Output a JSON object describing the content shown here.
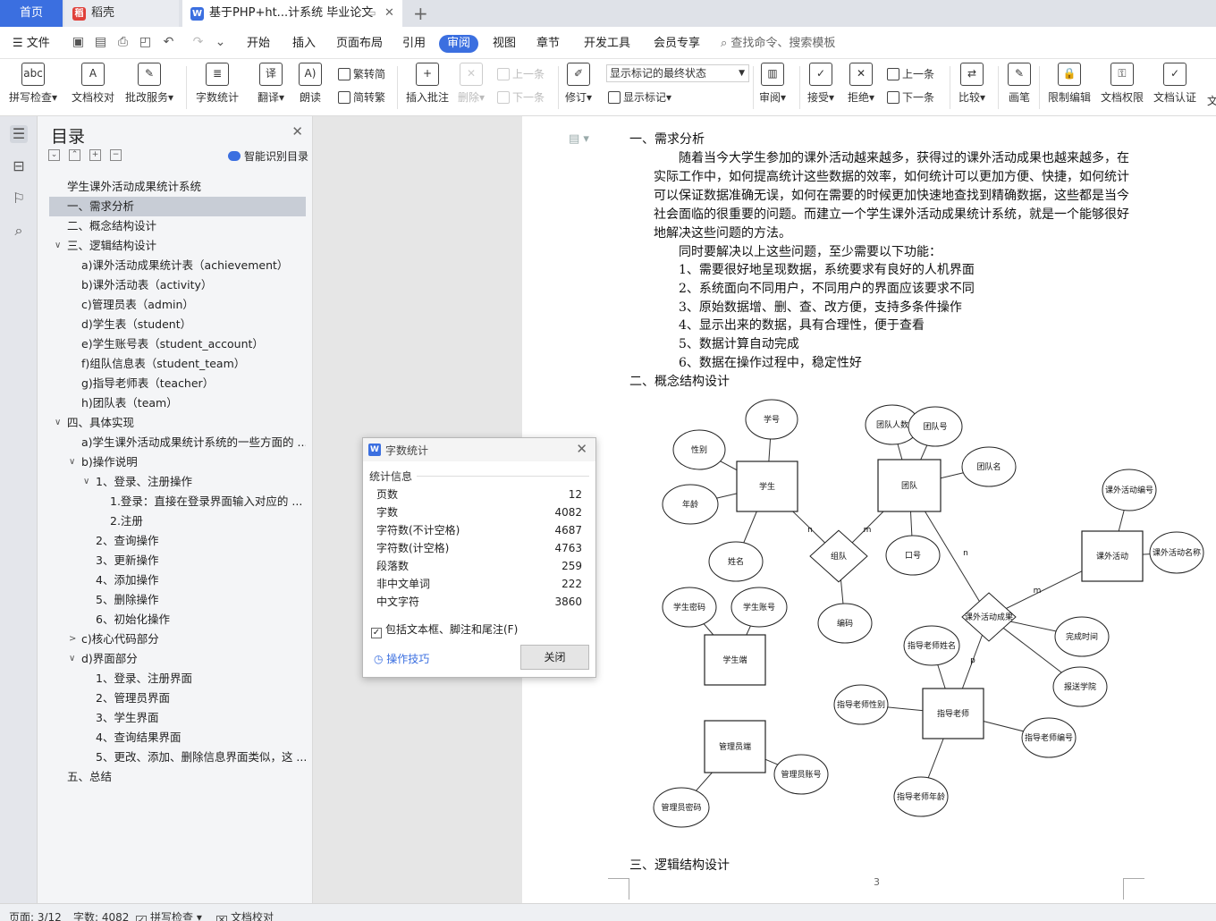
{
  "tabs": {
    "home": "首页",
    "wps": "稻壳",
    "doc": "基于PHP+ht...计系统 毕业论文"
  },
  "menu": {
    "file": "文件",
    "items": [
      "开始",
      "插入",
      "页面布局",
      "引用",
      "审阅",
      "视图",
      "章节",
      "开发工具",
      "会员专享"
    ],
    "active": "审阅",
    "search": "查找命令、搜索模板"
  },
  "ribbon": {
    "spell": "拼写检查",
    "proof": "文档校对",
    "batch": "批改服务",
    "wordcount": "字数统计",
    "translate": "翻译",
    "read": "朗读",
    "trad": "繁转简",
    "simp": "简转繁",
    "comment": "插入批注",
    "delete": "删除",
    "prev_c": "上一条",
    "next_c": "下一条",
    "revise": "修订",
    "markup_state": "显示标记的最终状态",
    "show_markup": "显示标记",
    "review": "审阅",
    "accept": "接受",
    "reject": "拒绝",
    "prev": "上一条",
    "next": "下一条",
    "compare": "比较",
    "pen": "画笔",
    "restrict": "限制编辑",
    "perm": "文档权限",
    "auth": "文档认证",
    "more": "文"
  },
  "nav": {
    "title": "目录",
    "smart": "智能识别目录",
    "items": [
      {
        "text": "学生课外活动成果统计系统",
        "level": 0
      },
      {
        "text": "一、需求分析",
        "level": 0,
        "selected": true
      },
      {
        "text": "二、概念结构设计",
        "level": 0
      },
      {
        "text": "三、逻辑结构设计",
        "level": 0,
        "caret": "v"
      },
      {
        "text": "a)课外活动成果统计表（achievement）",
        "level": 1
      },
      {
        "text": "b)课外活动表（activity）",
        "level": 1
      },
      {
        "text": "c)管理员表（admin）",
        "level": 1
      },
      {
        "text": "d)学生表（student）",
        "level": 1
      },
      {
        "text": "e)学生账号表（student_account）",
        "level": 1
      },
      {
        "text": "f)组队信息表（student_team）",
        "level": 1
      },
      {
        "text": "g)指导老师表（teacher）",
        "level": 1
      },
      {
        "text": "h)团队表（team）",
        "level": 1
      },
      {
        "text": "四、具体实现",
        "level": 0,
        "caret": "v"
      },
      {
        "text": "a)学生课外活动成果统计系统的一些方面的 ...",
        "level": 1
      },
      {
        "text": "b)操作说明",
        "level": 1,
        "caret": "v"
      },
      {
        "text": "1、登录、注册操作",
        "level": 2,
        "caret": "v"
      },
      {
        "text": "1.登录：直接在登录界面输入对应的 ...",
        "level": 3
      },
      {
        "text": "2.注册",
        "level": 3
      },
      {
        "text": "2、查询操作",
        "level": 2
      },
      {
        "text": "3、更新操作",
        "level": 2
      },
      {
        "text": "4、添加操作",
        "level": 2
      },
      {
        "text": "5、删除操作",
        "level": 2
      },
      {
        "text": "6、初始化操作",
        "level": 2
      },
      {
        "text": "c)核心代码部分",
        "level": 1,
        "caret": ">"
      },
      {
        "text": "d)界面部分",
        "level": 1,
        "caret": "v"
      },
      {
        "text": "1、登录、注册界面",
        "level": 2
      },
      {
        "text": "2、管理员界面",
        "level": 2
      },
      {
        "text": "3、学生界面",
        "level": 2
      },
      {
        "text": "4、查询结果界面",
        "level": 2
      },
      {
        "text": "5、更改、添加、删除信息界面类似，这 ...",
        "level": 2
      },
      {
        "text": "五、总结",
        "level": 0
      }
    ]
  },
  "doc": {
    "h1": "一、需求分析",
    "para1": [
      "随着当今大学生参加的课外活动越来越多，获得过的课外活动成果也越来越多，在",
      "实际工作中，如何提高统计这些数据的效率，如何统计可以更加方便、快捷，如何统计",
      "可以保证数据准确无误，如何在需要的时候更加快速地查找到精确数据，这些都是当今",
      "社会面临的很重要的问题。而建立一个学生课外活动成果统计系统，就是一个能够很好",
      "地解决这些问题的方法。"
    ],
    "para2": "同时要解决以上这些问题，至少需要以下功能：",
    "list": [
      "1、需要很好地呈现数据，系统要求有良好的人机界面",
      "2、系统面向不同用户，不同用户的界面应该要求不同",
      "3、原始数据增、删、查、改方便，支持多条件操作",
      "4、显示出来的数据，具有合理性，便于查看",
      "5、数据计算自动完成",
      "6、数据在操作过程中，稳定性好"
    ],
    "h2": "二、概念结构设计",
    "h3": "三、逻辑结构设计",
    "page_no": "3"
  },
  "erd": {
    "entities": [
      "学生",
      "团队",
      "课外活动",
      "学生端",
      "指导老师",
      "管理员端"
    ],
    "relations": [
      "组队",
      "课外活动成果"
    ],
    "attributes": [
      "学号",
      "性别",
      "年龄",
      "姓名",
      "团队人数",
      "团队号",
      "团队名",
      "口号",
      "编码",
      "课外活动编号",
      "课外活动名称",
      "完成时间",
      "报送学院",
      "学生密码",
      "学生账号",
      "指导老师姓名",
      "指导老师性别",
      "指导老师编号",
      "指导老师年龄",
      "管理员账号",
      "管理员密码"
    ],
    "cardinality": [
      "n",
      "m",
      "n",
      "m",
      "p"
    ]
  },
  "dialog": {
    "title": "字数统计",
    "section": "统计信息",
    "rows": [
      {
        "label": "页数",
        "value": "12"
      },
      {
        "label": "字数",
        "value": "4082"
      },
      {
        "label": "字符数(不计空格)",
        "value": "4687"
      },
      {
        "label": "字符数(计空格)",
        "value": "4763"
      },
      {
        "label": "段落数",
        "value": "259"
      },
      {
        "label": "非中文单词",
        "value": "222"
      },
      {
        "label": "中文字符",
        "value": "3860"
      }
    ],
    "checkbox": "包括文本框、脚注和尾注(F)",
    "checked": true,
    "tips": "操作技巧",
    "close": "关闭"
  },
  "status": {
    "page": "页面: 3/12",
    "words": "字数: 4082",
    "spell": "拼写检查",
    "proof": "文档校对"
  }
}
